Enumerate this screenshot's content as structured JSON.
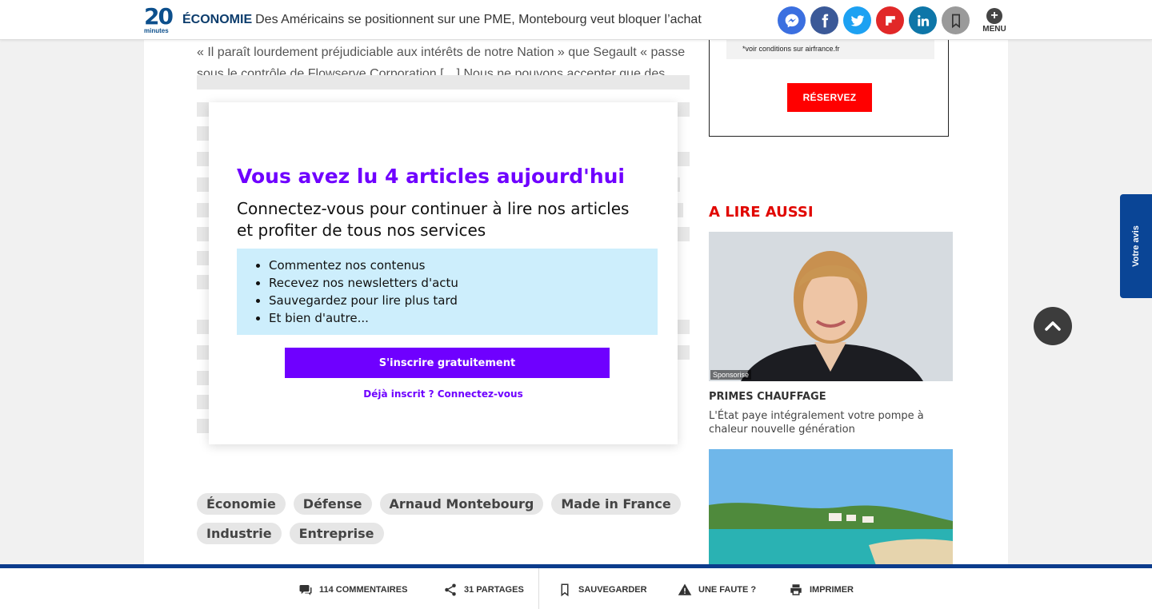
{
  "header": {
    "logo_number": "20",
    "logo_sub": "minutes",
    "rubric": "ÉCONOMIE",
    "headline": "Des Américains se positionnent sur une PME, Montebourg veut bloquer l’achat",
    "menu_label": "MENU",
    "menu_plus": "+",
    "share": [
      {
        "name": "messenger-icon",
        "color": "#3b6fe0"
      },
      {
        "name": "facebook-icon",
        "color": "#3b5998"
      },
      {
        "name": "twitter-icon",
        "color": "#1da1f2"
      },
      {
        "name": "flipboard-icon",
        "color": "#e12828"
      },
      {
        "name": "linkedin-icon",
        "color": "#0e76a8"
      }
    ]
  },
  "article": {
    "text": "« Il paraît lourdement préjudiciable aux intérêts de notre Nation » que Segault « passe sous le contrôle de Flowserve Corporation […] Nous ne pouvons accepter que des"
  },
  "paywall": {
    "title": "Vous avez lu 4 articles aujourd'hui",
    "subtitle": "Connectez-vous pour continuer à lire nos articles et profiter de tous nos services",
    "benefits": [
      "Commentez nos contenus",
      "Recevez nos newsletters d'actu",
      "Sauvegardez pour lire plus tard",
      "Et bien d'autre..."
    ],
    "cta": "S'inscrire gratuitement",
    "login": "Déjà inscrit ? Connectez-vous",
    "accent_color": "#6f00ff"
  },
  "tags": [
    "Économie",
    "Défense",
    "Arnaud Montebourg",
    "Made in France",
    "Industrie",
    "Entreprise"
  ],
  "sidebar": {
    "ad_conditions": "*voir conditions sur airfrance.fr",
    "ad_button": "RÉSERVEZ",
    "section_title": "A LIRE AUSSI",
    "card1": {
      "badge": "Sponsorisé",
      "title": "PRIMES CHAUFFAGE",
      "desc": "L'État paye intégralement votre pompe à chaleur nouvelle génération"
    }
  },
  "floating": {
    "feedback": "Votre avis"
  },
  "bottombar": {
    "comments": "114 COMMENTAIRES",
    "shares": "31 PARTAGES",
    "save": "SAUVEGARDER",
    "fault": "UNE FAUTE ?",
    "print": "IMPRIMER"
  }
}
